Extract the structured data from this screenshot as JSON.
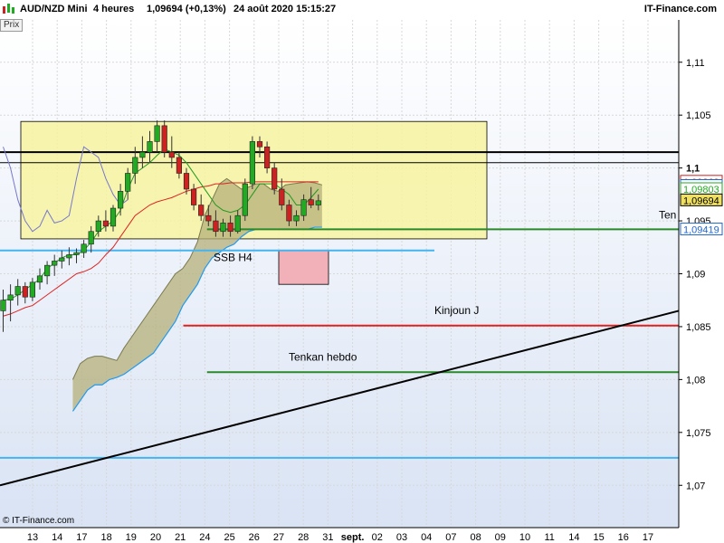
{
  "header": {
    "symbol": "AUD/NZD Mini",
    "timeframe": "4 heures",
    "quote": "1,09694 (+0,13%)",
    "datetime": "24 août 2020 15:15:27",
    "brand": "IT-Finance.com",
    "price_tab": "Prix",
    "icon": "chart-logo-icon"
  },
  "footer": {
    "copyright": "© IT-Finance.com"
  },
  "colors": {
    "up_candle": "#22aa22",
    "down_candle": "#cc2222",
    "kumo_fill": "#b5b07a",
    "current_price_bg": "#f0e060",
    "zone_fill": "#f7f3a0",
    "zone2_fill": "#f2b0b8"
  },
  "chart_data": {
    "type": "candlestick",
    "y_ticks": [
      "1,11",
      "1,105",
      "1,1",
      "1,095",
      "1,09",
      "1,085",
      "1,08",
      "1,075",
      "1,07"
    ],
    "x_ticks": [
      "13",
      "14",
      "17",
      "18",
      "19",
      "20",
      "21",
      "24",
      "25",
      "26",
      "27",
      "28",
      "31",
      "sept.",
      "02",
      "03",
      "04",
      "07",
      "08",
      "09",
      "10",
      "11",
      "14",
      "15",
      "16",
      "17"
    ],
    "ylim": [
      1.066,
      1.114
    ],
    "price_labels": [
      {
        "text": "1,09869",
        "value": 1.0987,
        "color": "#cc2222",
        "bg": "#ffffff"
      },
      {
        "text": "1,09834",
        "value": 1.0983,
        "color": "#2266cc",
        "bg": "#ffffff"
      },
      {
        "text": "1,09803",
        "value": 1.098,
        "color": "#22aa22",
        "bg": "#ffffff"
      },
      {
        "text": "1,09694",
        "value": 1.09694,
        "color": "#000000",
        "bg": "#f0e060"
      },
      {
        "text": "1,09419",
        "value": 1.09419,
        "color": "#2266cc",
        "bg": "#ffffff"
      }
    ],
    "annotations": [
      "SSB H4",
      "Kinjoun J",
      "Tenkan hebdo",
      "Ten"
    ],
    "candles": [
      [
        1.0865,
        1.0885,
        1.0845,
        1.0875
      ],
      [
        1.0875,
        1.089,
        1.0855,
        1.088
      ],
      [
        1.088,
        1.0895,
        1.087,
        1.0888
      ],
      [
        1.0888,
        1.0892,
        1.0872,
        1.0878
      ],
      [
        1.0878,
        1.0896,
        1.0874,
        1.0892
      ],
      [
        1.0892,
        1.0905,
        1.0885,
        1.0898
      ],
      [
        1.0898,
        1.0912,
        1.089,
        1.0908
      ],
      [
        1.0908,
        1.0918,
        1.0898,
        1.0912
      ],
      [
        1.0912,
        1.0922,
        1.0905,
        1.0915
      ],
      [
        1.0915,
        1.0925,
        1.0908,
        1.0918
      ],
      [
        1.0918,
        1.0924,
        1.091,
        1.092
      ],
      [
        1.092,
        1.0932,
        1.0915,
        1.0928
      ],
      [
        1.0928,
        1.0945,
        1.092,
        1.094
      ],
      [
        1.094,
        1.0955,
        1.0935,
        1.095
      ],
      [
        1.095,
        1.096,
        1.094,
        1.0945
      ],
      [
        1.0945,
        1.0965,
        1.094,
        1.0962
      ],
      [
        1.0962,
        1.0985,
        1.0955,
        1.0978
      ],
      [
        1.0978,
        1.1,
        1.097,
        1.0995
      ],
      [
        1.0995,
        1.102,
        1.0985,
        1.101
      ],
      [
        1.101,
        1.103,
        1.1,
        1.1015
      ],
      [
        1.1015,
        1.1035,
        1.1005,
        1.1025
      ],
      [
        1.1025,
        1.1045,
        1.1015,
        1.104
      ],
      [
        1.104,
        1.1045,
        1.101,
        1.1015
      ],
      [
        1.1015,
        1.103,
        1.1,
        1.101
      ],
      [
        1.101,
        1.1015,
        1.099,
        1.0995
      ],
      [
        1.0995,
        1.1,
        1.0975,
        1.098
      ],
      [
        1.098,
        1.0985,
        1.096,
        1.0965
      ],
      [
        1.0965,
        1.0975,
        1.095,
        1.0955
      ],
      [
        1.0955,
        1.0965,
        1.0945,
        1.095
      ],
      [
        1.095,
        1.096,
        1.0935,
        1.094
      ],
      [
        1.094,
        1.0952,
        1.0935,
        1.0948
      ],
      [
        1.0948,
        1.0955,
        1.0935,
        1.094
      ],
      [
        1.094,
        1.096,
        1.0938,
        1.0955
      ],
      [
        1.0955,
        1.099,
        1.095,
        1.0985
      ],
      [
        1.0985,
        1.103,
        1.098,
        1.1025
      ],
      [
        1.1025,
        1.103,
        1.101,
        1.102
      ],
      [
        1.102,
        1.1025,
        1.0995,
        1.1
      ],
      [
        1.1,
        1.1005,
        1.0975,
        1.098
      ],
      [
        1.098,
        1.099,
        1.096,
        1.0965
      ],
      [
        1.0965,
        1.097,
        1.0945,
        1.095
      ],
      [
        1.095,
        1.096,
        1.0945,
        1.0955
      ],
      [
        1.0955,
        1.0975,
        1.095,
        1.097
      ],
      [
        1.097,
        1.0982,
        1.0962,
        1.0965
      ],
      [
        1.0965,
        1.0975,
        1.096,
        1.0969
      ]
    ],
    "chikou": [
      1.102,
      1.1,
      1.097,
      1.095,
      1.094,
      1.0945,
      1.096,
      1.0948,
      1.095,
      1.0955,
      1.099,
      1.102,
      1.1015,
      1.101,
      1.099,
      1.0975,
      1.0965,
      1.097
    ],
    "tenkan": [
      1.0875,
      1.0876,
      1.088,
      1.0885,
      1.089,
      1.0895,
      1.0905,
      1.091,
      1.0915,
      1.0918,
      1.0918,
      1.0922,
      1.093,
      1.094,
      1.0945,
      1.095,
      1.096,
      1.098,
      1.0995,
      1.1,
      1.1005,
      1.1012,
      1.1018,
      1.1015,
      1.1012,
      1.1005,
      1.0995,
      1.0985,
      1.0975,
      1.0965,
      1.096,
      1.0958,
      1.096,
      1.0965,
      1.0975,
      1.0985,
      1.0985,
      1.0985,
      1.098,
      1.0975,
      1.0965,
      1.0965,
      1.0972,
      1.098
    ],
    "kijun": [
      1.086,
      1.0862,
      1.0865,
      1.0868,
      1.087,
      1.0875,
      1.088,
      1.0885,
      1.089,
      1.0895,
      1.09,
      1.0902,
      1.0905,
      1.091,
      1.0918,
      1.0925,
      1.0935,
      1.0945,
      1.0955,
      1.096,
      1.0965,
      1.0968,
      1.097,
      1.0972,
      1.0975,
      1.0978,
      1.098,
      1.0982,
      1.0983,
      1.0985,
      1.0985,
      1.0986,
      1.0986,
      1.0986,
      1.0987,
      1.0987,
      1.0987,
      1.0987,
      1.0987,
      1.0987,
      1.0987,
      1.0987,
      1.0987,
      1.0987
    ],
    "ssa": [
      1.08,
      1.0815,
      1.082,
      1.0822,
      1.0822,
      1.082,
      1.0818,
      1.083,
      1.084,
      1.085,
      1.086,
      1.087,
      1.088,
      1.089,
      1.09,
      1.0905,
      1.0915,
      1.093,
      1.0955,
      1.097,
      1.0985,
      1.099,
      1.0985,
      1.098,
      1.0982,
      1.0985,
      1.0985,
      1.098,
      1.0978,
      1.0984,
      1.0985,
      1.0986,
      1.0987,
      1.0986,
      1.0984
    ],
    "ssb": [
      1.077,
      1.078,
      1.079,
      1.0795,
      1.0795,
      1.08,
      1.0802,
      1.0805,
      1.081,
      1.0815,
      1.082,
      1.0825,
      1.0835,
      1.0845,
      1.0855,
      1.087,
      1.088,
      1.089,
      1.0905,
      1.0915,
      1.092,
      1.0925,
      1.0928,
      1.0935,
      1.094,
      1.0942,
      1.0942,
      1.0942,
      1.0942,
      1.0942,
      1.0942,
      1.0942,
      1.0942,
      1.0944,
      1.0944
    ],
    "hlines": [
      {
        "value": 1.1015,
        "color": "#000000",
        "width": 2,
        "from": 0,
        "to": 1
      },
      {
        "value": 1.1005,
        "color": "#000000",
        "width": 1,
        "from": 0,
        "to": 1
      },
      {
        "value": 1.0942,
        "color": "#2a8a2a",
        "width": 2,
        "from": 0.305,
        "to": 1
      },
      {
        "value": 1.0922,
        "color": "#44b4f0",
        "width": 2,
        "from": 0,
        "to": 0.64
      },
      {
        "value": 1.0851,
        "color": "#dd2222",
        "width": 2,
        "from": 0.27,
        "to": 1
      },
      {
        "value": 1.0807,
        "color": "#2a8a2a",
        "width": 2,
        "from": 0.305,
        "to": 1
      },
      {
        "value": 1.0726,
        "color": "#44b4f0",
        "width": 2,
        "from": 0,
        "to": 1
      }
    ]
  }
}
